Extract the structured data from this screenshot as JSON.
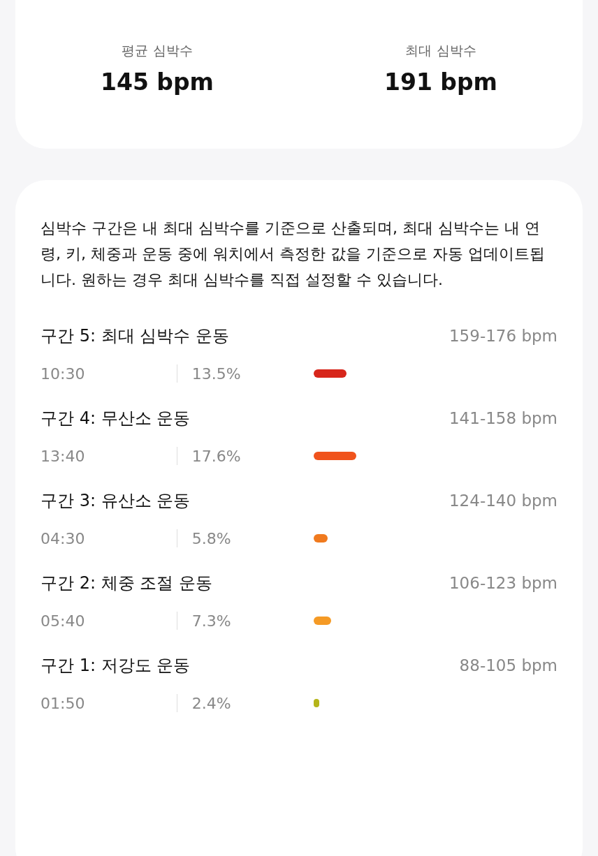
{
  "summary": [
    {
      "label": "평균 심박수",
      "value": "145 bpm"
    },
    {
      "label": "최대 심박수",
      "value": "191 bpm"
    }
  ],
  "description": "심박수 구간은 내 최대 심박수를 기준으로 산출되며, 최대 심박수는 내 연령, 키, 체중과 운동 중에 워치에서 측정한 값을 기준으로 자동 업데이트됩니다. 원하는 경우 최대 심박수를 직접 설정할 수 있습니다.",
  "zones": [
    {
      "title": "구간 5: 최대 심박수 운동",
      "range": "159-176 bpm",
      "time": "10:30",
      "percent": "13.5%",
      "color": "#d7261b"
    },
    {
      "title": "구간 4: 무산소 운동",
      "range": "141-158 bpm",
      "time": "13:40",
      "percent": "17.6%",
      "color": "#f0531c"
    },
    {
      "title": "구간 3: 유산소 운동",
      "range": "124-140 bpm",
      "time": "04:30",
      "percent": "5.8%",
      "color": "#f07a1e"
    },
    {
      "title": "구간 2: 체중 조절 운동",
      "range": "106-123 bpm",
      "time": "05:40",
      "percent": "7.3%",
      "color": "#f59a25"
    },
    {
      "title": "구간 1: 저강도 운동",
      "range": "88-105 bpm",
      "time": "01:50",
      "percent": "2.4%",
      "color": "#b5b51a"
    }
  ]
}
